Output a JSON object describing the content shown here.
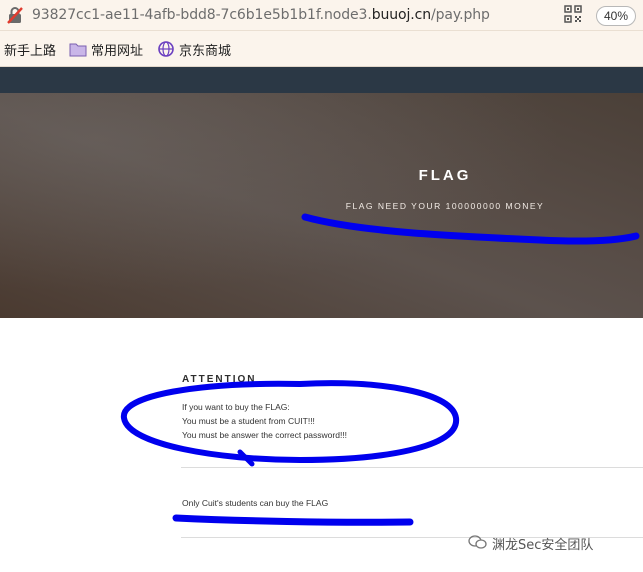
{
  "browser": {
    "url_prefix": "93827cc1-ae11-4afb-bdd8-7c6b1e5b1b1f.node3.",
    "url_domain": "buuoj.cn",
    "url_path": "/pay.php",
    "zoom": "40%"
  },
  "bookmarks": [
    {
      "label": "新手上路",
      "icon": "compass-icon"
    },
    {
      "label": "常用网址",
      "icon": "folder-icon"
    },
    {
      "label": "京东商城",
      "icon": "globe-icon"
    }
  ],
  "hero": {
    "title": "FLAG",
    "subtitle": "FLAG NEED YOUR 100000000 MONEY"
  },
  "attention": {
    "heading": "ATTENTION",
    "lines": [
      "If you want to buy the FLAG:",
      "You must be a student from CUIT!!!",
      "You must be answer the correct password!!!"
    ]
  },
  "note": "Only Cuit's students can buy the FLAG",
  "watermark": "渊龙Sec安全团队",
  "colors": {
    "annotation": "#0000ee",
    "navbar": "#2b3845",
    "browser_bar": "#fbf4ec"
  }
}
